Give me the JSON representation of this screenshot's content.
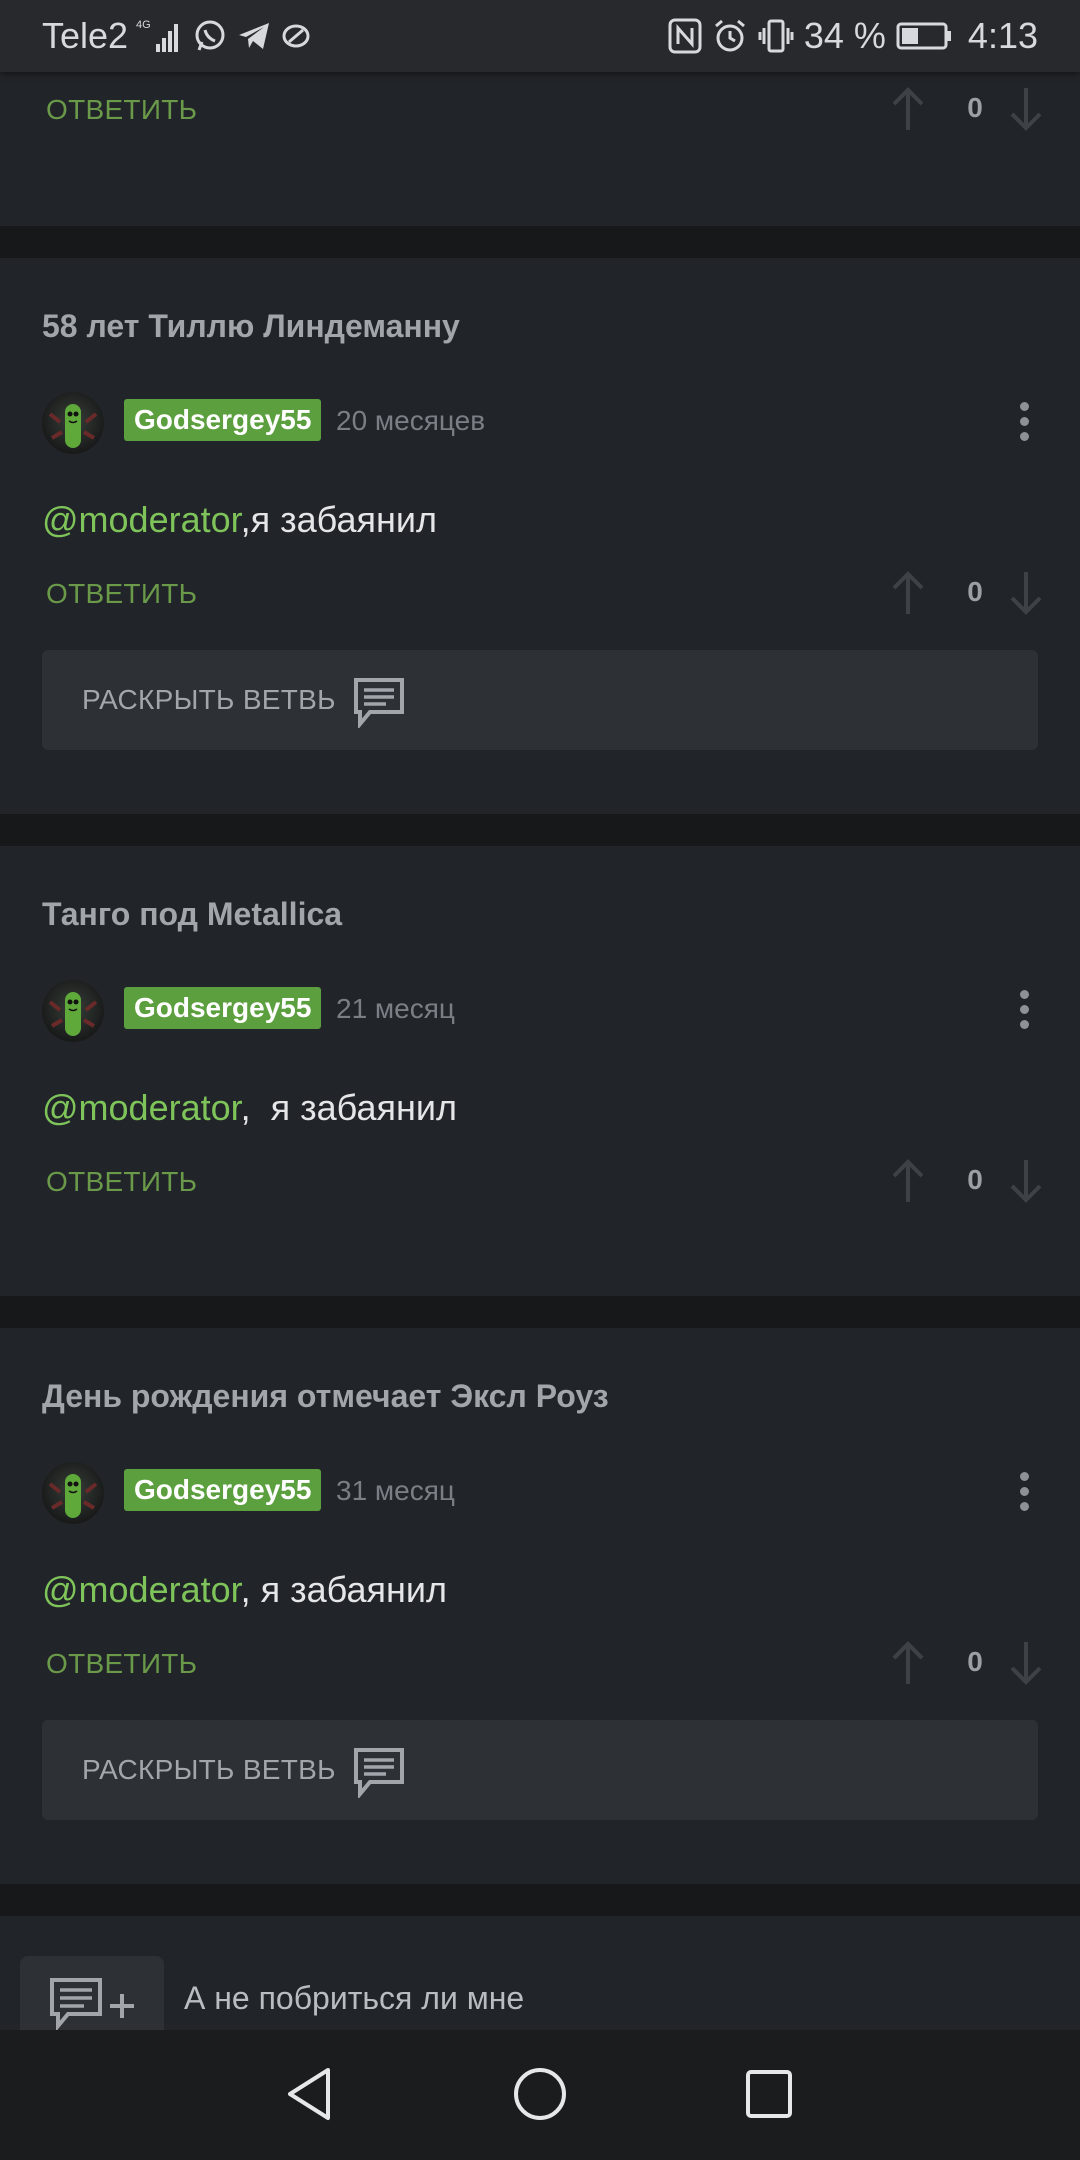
{
  "status_bar": {
    "carrier": "Tele2",
    "network": "4G",
    "battery": "34 %",
    "time": "4:13"
  },
  "top_partial": {
    "reply_label": "ОТВЕТИТЬ",
    "votes": "0"
  },
  "posts": [
    {
      "title": "58 лет Тиллю Линдеманну",
      "username": "Godsergey55",
      "time": "20 месяцев",
      "mention": "@moderator",
      "text": ",я забаянил",
      "reply_label": "ОТВЕТИТЬ",
      "votes": "0",
      "expand_label": "РАСКРЫТЬ ВЕТВЬ"
    },
    {
      "title": "Танго под Metallica",
      "username": "Godsergey55",
      "time": "21 месяц",
      "mention": "@moderator",
      "text": ",  я забаянил",
      "reply_label": "ОТВЕТИТЬ",
      "votes": "0"
    },
    {
      "title": "День рождения отмечает Эксл Роуз",
      "username": "Godsergey55",
      "time": "31 месяц",
      "mention": "@moderator",
      "text": ", я забаянил",
      "reply_label": "ОТВЕТИТЬ",
      "votes": "0",
      "expand_label": "РАСКРЫТЬ ВЕТВЬ"
    }
  ],
  "comment_input": {
    "placeholder": "А не побриться ли мне"
  },
  "colors": {
    "background": "#212428",
    "separator": "#161819",
    "username_badge": "#5c9f3e",
    "mention": "#7fc45a",
    "reply": "#6a9a49"
  },
  "icons": [
    "signal-icon",
    "whatsapp-icon",
    "telegram-icon",
    "app-icon",
    "nfc-icon",
    "alarm-icon",
    "vibrate-icon",
    "battery-icon",
    "arrow-up-icon",
    "arrow-down-icon",
    "comment-icon",
    "more-icon",
    "add-comment-icon",
    "back-icon",
    "home-icon",
    "recents-icon"
  ]
}
